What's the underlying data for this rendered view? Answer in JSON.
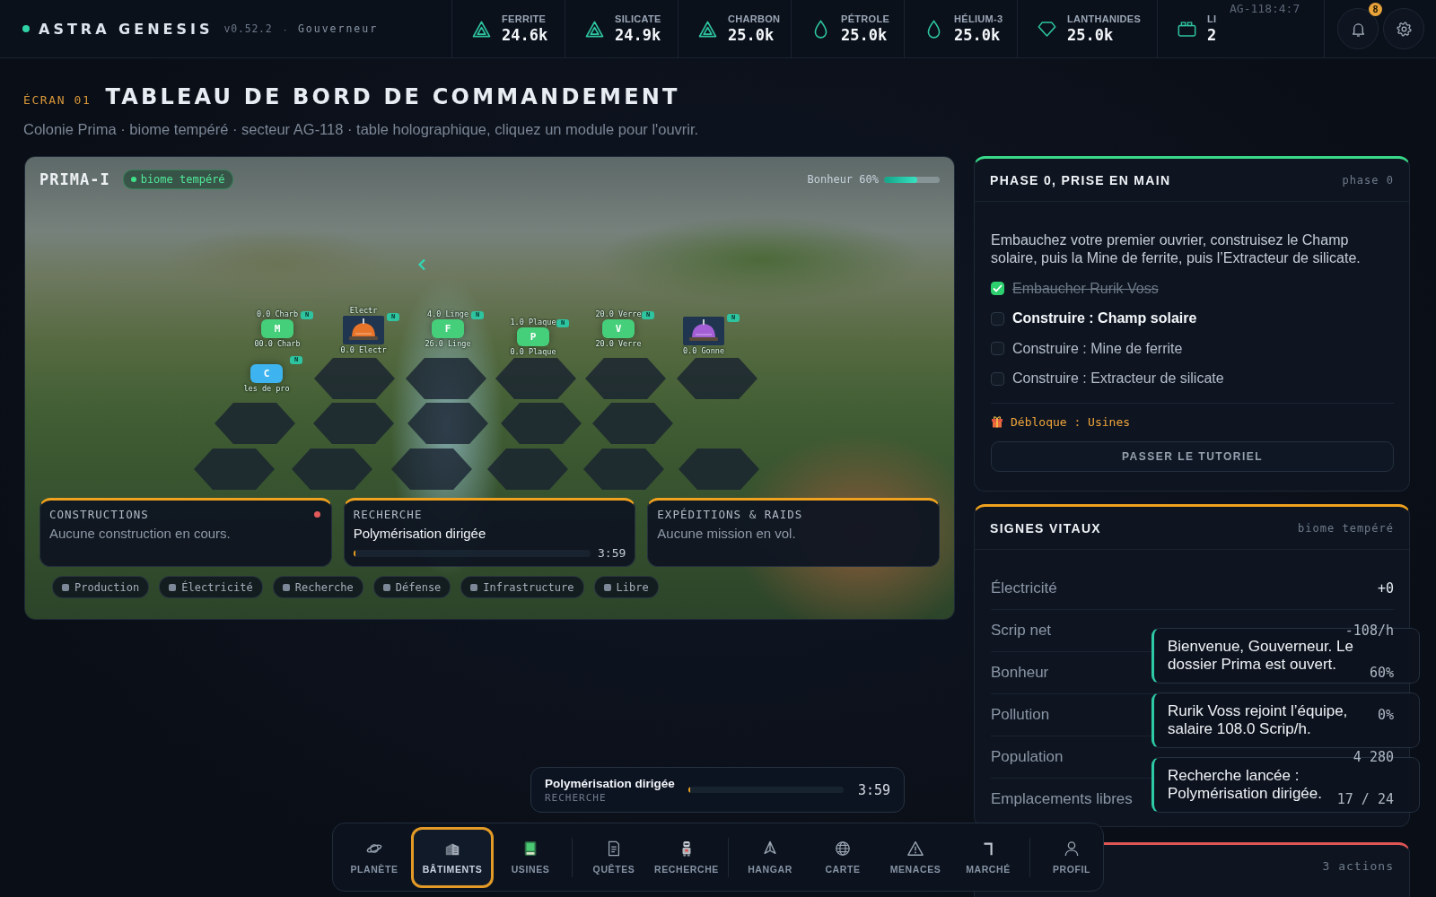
{
  "header": {
    "brand": "ASTRA GENESIS",
    "version": "v0.52.2",
    "separator": "·",
    "role": "Gouverneur",
    "sector_code": "AG-118:4:7",
    "notification_count": "8"
  },
  "resources": [
    {
      "kind": "mineral",
      "label": "FERRITE",
      "value": "24.6k"
    },
    {
      "kind": "mineral",
      "label": "SILICATE",
      "value": "24.9k"
    },
    {
      "kind": "mineral",
      "label": "CHARBON",
      "value": "25.0k"
    },
    {
      "kind": "liquid",
      "label": "PÉTROLE",
      "value": "25.0k"
    },
    {
      "kind": "liquid",
      "label": "HÉLIUM-3",
      "value": "25.0k"
    },
    {
      "kind": "gem",
      "label": "LANTHANIDES",
      "value": "25.0k"
    },
    {
      "kind": "storage",
      "label": "LI",
      "value": "2"
    }
  ],
  "page": {
    "screen": "ÉCRAN 01",
    "title": "TABLEAU DE BORD DE COMMANDEMENT",
    "subtitle": "Colonie Prima · biome tempéré · secteur AG-118 · table holographique, cliquez un module pour l'ouvrir."
  },
  "map": {
    "name": "PRIMA-I",
    "biome": "biome tempéré",
    "happiness": {
      "label": "Bonheur 60%",
      "level": 0.6
    },
    "tiles": [
      {
        "kind": "letter",
        "letter": "M",
        "color": "#46cf7a",
        "top_label": "0.0 Charb",
        "bottom_label": "00.0 Charb",
        "badge": "N"
      },
      {
        "kind": "building",
        "color": "#e8742a",
        "top_label": "Electr",
        "bottom_label": "0.0 Electr",
        "badge": "N"
      },
      {
        "kind": "letter",
        "letter": "F",
        "color": "#46cf7a",
        "top_label": "4.0 Linge",
        "bottom_label": "26.0 Linge",
        "badge": "N"
      },
      {
        "kind": "letter",
        "letter": "P",
        "color": "#46cf7a",
        "top_label": "1.0 Plaque",
        "bottom_label": "0.0 Plaque",
        "badge": "N"
      },
      {
        "kind": "letter",
        "letter": "V",
        "color": "#46cf7a",
        "top_label": "20.0 Verre",
        "bottom_label": "20.0 Verre",
        "badge": "N"
      },
      {
        "kind": "building",
        "color": "#a45fd6",
        "bottom_label": "0.0 Gonne",
        "badge": "N"
      },
      {
        "kind": "letter",
        "letter": "C",
        "color": "#3db4ef",
        "bottom_label": "les de pro",
        "badge": "N"
      }
    ],
    "status_cards": [
      {
        "kind": "text",
        "title": "CONSTRUCTIONS",
        "text": "Aucune construction en cours.",
        "alert": true
      },
      {
        "kind": "progress",
        "title": "RECHERCHE",
        "text": "Polymérisation dirigée",
        "level": 0.01,
        "time": "3:59"
      },
      {
        "kind": "text",
        "title": "EXPÉDITIONS & RAIDS",
        "text": "Aucune mission en vol.",
        "alert": false
      }
    ],
    "legend": [
      "Production",
      "Électricité",
      "Recherche",
      "Défense",
      "Infrastructure",
      "Libre"
    ]
  },
  "tutorial": {
    "title": "PHASE 0, PRISE EN MAIN",
    "tag": "phase 0",
    "text": "Embauchez votre premier ouvrier, construisez le Champ solaire, puis la Mine de ferrite, puis l’Extracteur de silicate.",
    "tasks": [
      {
        "label": "Embaucher Rurik Voss",
        "checked": true,
        "current": false
      },
      {
        "label": "Construire : Champ solaire",
        "checked": false,
        "current": true
      },
      {
        "label": "Construire : Mine de ferrite",
        "checked": false,
        "current": false
      },
      {
        "label": "Construire : Extracteur de silicate",
        "checked": false,
        "current": false
      }
    ],
    "unlock": "Débloque : Usines",
    "button": "PASSER LE TUTORIEL"
  },
  "vitals": {
    "title": "SIGNES VITAUX",
    "tag": "biome tempéré",
    "rows": [
      {
        "label": "Électricité",
        "value": "+0"
      },
      {
        "label": "Scrip net",
        "value": "-108/h"
      },
      {
        "label": "Bonheur",
        "value": "60%"
      },
      {
        "label": "Pollution",
        "value": "0%"
      },
      {
        "label": "Population",
        "value": "4 280"
      },
      {
        "label": "Emplacements libres",
        "value": "17 / 24"
      }
    ]
  },
  "actions": {
    "count": "3 actions"
  },
  "research_bar": {
    "name": "Polymérisation dirigée",
    "category": "RECHERCHE",
    "level": 0.01,
    "time": "3:59"
  },
  "nav": {
    "groups": [
      [
        {
          "kind": "planet",
          "label": "PLANÈTE",
          "selected": false
        },
        {
          "kind": "building",
          "label": "BÂTIMENTS",
          "selected": true
        },
        {
          "kind": "factory",
          "label": "USINES",
          "selected": false
        }
      ],
      [
        {
          "kind": "document",
          "label": "QUÊTES",
          "selected": false
        },
        {
          "kind": "robot",
          "label": "RECHERCHE",
          "selected": false
        }
      ],
      [
        {
          "kind": "ship",
          "label": "HANGAR",
          "selected": false
        },
        {
          "kind": "globe",
          "label": "CARTE",
          "selected": false
        },
        {
          "kind": "warning",
          "label": "MENACES",
          "selected": false
        },
        {
          "kind": "market",
          "label": "MARCHÉ",
          "selected": false
        }
      ],
      [
        {
          "kind": "person",
          "label": "PROFIL",
          "selected": false
        }
      ]
    ]
  },
  "toasts": [
    "Bienvenue, Gouverneur. Le dossier Prima est ouvert.",
    "Rurik Voss rejoint l’équipe, salaire 108.0 Scrip/h.",
    "Recherche lancée : Polymérisation dirigée."
  ]
}
